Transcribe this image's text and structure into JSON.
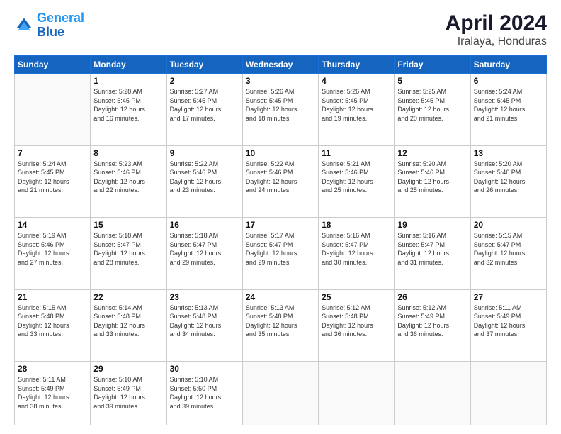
{
  "logo": {
    "line1": "General",
    "line2": "Blue"
  },
  "title": "April 2024",
  "subtitle": "Iralaya, Honduras",
  "weekdays": [
    "Sunday",
    "Monday",
    "Tuesday",
    "Wednesday",
    "Thursday",
    "Friday",
    "Saturday"
  ],
  "days": [
    {
      "num": "",
      "info": ""
    },
    {
      "num": "1",
      "info": "Sunrise: 5:28 AM\nSunset: 5:45 PM\nDaylight: 12 hours\nand 16 minutes."
    },
    {
      "num": "2",
      "info": "Sunrise: 5:27 AM\nSunset: 5:45 PM\nDaylight: 12 hours\nand 17 minutes."
    },
    {
      "num": "3",
      "info": "Sunrise: 5:26 AM\nSunset: 5:45 PM\nDaylight: 12 hours\nand 18 minutes."
    },
    {
      "num": "4",
      "info": "Sunrise: 5:26 AM\nSunset: 5:45 PM\nDaylight: 12 hours\nand 19 minutes."
    },
    {
      "num": "5",
      "info": "Sunrise: 5:25 AM\nSunset: 5:45 PM\nDaylight: 12 hours\nand 20 minutes."
    },
    {
      "num": "6",
      "info": "Sunrise: 5:24 AM\nSunset: 5:45 PM\nDaylight: 12 hours\nand 21 minutes."
    },
    {
      "num": "7",
      "info": "Sunrise: 5:24 AM\nSunset: 5:45 PM\nDaylight: 12 hours\nand 21 minutes."
    },
    {
      "num": "8",
      "info": "Sunrise: 5:23 AM\nSunset: 5:46 PM\nDaylight: 12 hours\nand 22 minutes."
    },
    {
      "num": "9",
      "info": "Sunrise: 5:22 AM\nSunset: 5:46 PM\nDaylight: 12 hours\nand 23 minutes."
    },
    {
      "num": "10",
      "info": "Sunrise: 5:22 AM\nSunset: 5:46 PM\nDaylight: 12 hours\nand 24 minutes."
    },
    {
      "num": "11",
      "info": "Sunrise: 5:21 AM\nSunset: 5:46 PM\nDaylight: 12 hours\nand 25 minutes."
    },
    {
      "num": "12",
      "info": "Sunrise: 5:20 AM\nSunset: 5:46 PM\nDaylight: 12 hours\nand 25 minutes."
    },
    {
      "num": "13",
      "info": "Sunrise: 5:20 AM\nSunset: 5:46 PM\nDaylight: 12 hours\nand 26 minutes."
    },
    {
      "num": "14",
      "info": "Sunrise: 5:19 AM\nSunset: 5:46 PM\nDaylight: 12 hours\nand 27 minutes."
    },
    {
      "num": "15",
      "info": "Sunrise: 5:18 AM\nSunset: 5:47 PM\nDaylight: 12 hours\nand 28 minutes."
    },
    {
      "num": "16",
      "info": "Sunrise: 5:18 AM\nSunset: 5:47 PM\nDaylight: 12 hours\nand 29 minutes."
    },
    {
      "num": "17",
      "info": "Sunrise: 5:17 AM\nSunset: 5:47 PM\nDaylight: 12 hours\nand 29 minutes."
    },
    {
      "num": "18",
      "info": "Sunrise: 5:16 AM\nSunset: 5:47 PM\nDaylight: 12 hours\nand 30 minutes."
    },
    {
      "num": "19",
      "info": "Sunrise: 5:16 AM\nSunset: 5:47 PM\nDaylight: 12 hours\nand 31 minutes."
    },
    {
      "num": "20",
      "info": "Sunrise: 5:15 AM\nSunset: 5:47 PM\nDaylight: 12 hours\nand 32 minutes."
    },
    {
      "num": "21",
      "info": "Sunrise: 5:15 AM\nSunset: 5:48 PM\nDaylight: 12 hours\nand 33 minutes."
    },
    {
      "num": "22",
      "info": "Sunrise: 5:14 AM\nSunset: 5:48 PM\nDaylight: 12 hours\nand 33 minutes."
    },
    {
      "num": "23",
      "info": "Sunrise: 5:13 AM\nSunset: 5:48 PM\nDaylight: 12 hours\nand 34 minutes."
    },
    {
      "num": "24",
      "info": "Sunrise: 5:13 AM\nSunset: 5:48 PM\nDaylight: 12 hours\nand 35 minutes."
    },
    {
      "num": "25",
      "info": "Sunrise: 5:12 AM\nSunset: 5:48 PM\nDaylight: 12 hours\nand 36 minutes."
    },
    {
      "num": "26",
      "info": "Sunrise: 5:12 AM\nSunset: 5:49 PM\nDaylight: 12 hours\nand 36 minutes."
    },
    {
      "num": "27",
      "info": "Sunrise: 5:11 AM\nSunset: 5:49 PM\nDaylight: 12 hours\nand 37 minutes."
    },
    {
      "num": "28",
      "info": "Sunrise: 5:11 AM\nSunset: 5:49 PM\nDaylight: 12 hours\nand 38 minutes."
    },
    {
      "num": "29",
      "info": "Sunrise: 5:10 AM\nSunset: 5:49 PM\nDaylight: 12 hours\nand 39 minutes."
    },
    {
      "num": "30",
      "info": "Sunrise: 5:10 AM\nSunset: 5:50 PM\nDaylight: 12 hours\nand 39 minutes."
    },
    {
      "num": "",
      "info": ""
    },
    {
      "num": "",
      "info": ""
    },
    {
      "num": "",
      "info": ""
    },
    {
      "num": "",
      "info": ""
    }
  ]
}
